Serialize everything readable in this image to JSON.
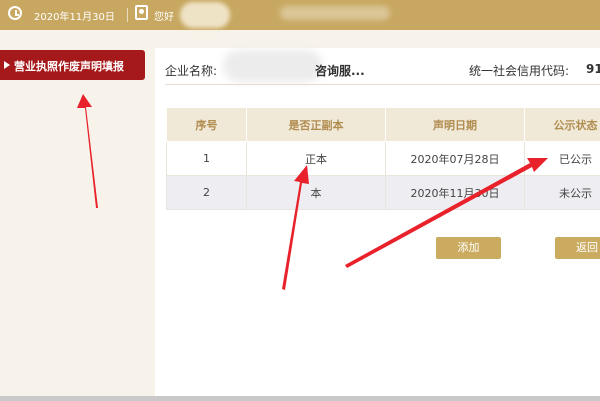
{
  "header": {
    "date": "2020年11月30日",
    "greeting": "您好"
  },
  "sidebar": {
    "items": [
      {
        "label": "营业执照作废声明填报",
        "active": true
      }
    ]
  },
  "main": {
    "company_name_label": "企业名称:",
    "company_name_value": "咨询服...",
    "credit_code_label": "统一社会信用代码:",
    "credit_code_value": "91",
    "table": {
      "columns": [
        "序号",
        "是否正副本",
        "声明日期",
        "公示状态"
      ],
      "rows": [
        [
          "1",
          "正本",
          "2020年07月28日",
          "已公示"
        ],
        [
          "2",
          "本",
          "2020年11月30日",
          "未公示"
        ]
      ]
    },
    "buttons": {
      "add": "添加",
      "back": "返回"
    }
  },
  "colors": {
    "topbar": "#c8a861",
    "menu_active": "#a6191b",
    "header_cell": "#f0e9d8",
    "header_text": "#b08c4f",
    "button": "#cbab60",
    "arrow": "#e8212b"
  },
  "icons": [
    "clock-icon",
    "user-id-icon",
    "play-triangle-icon"
  ]
}
